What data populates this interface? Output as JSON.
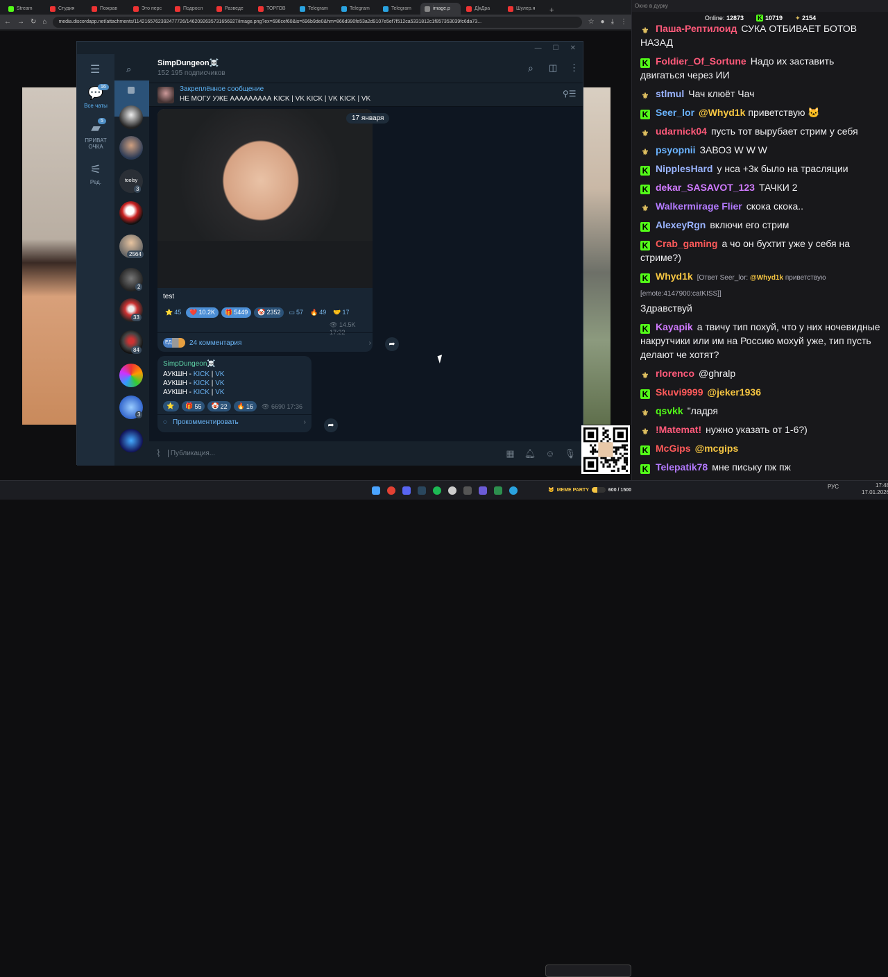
{
  "browser": {
    "tabs": [
      "Stream",
      "Студия",
      "Пожрав",
      "Это перс",
      "Подросл",
      "Разведе",
      "ТОРГОВ",
      "Telegram",
      "Telegram",
      "Telegram",
      "image.p",
      "Д|кДра",
      "Шулер.я"
    ],
    "active_tab_index": 10,
    "new_tab": "+",
    "url": "media.discordapp.net/attachments/1142165762392477726/1462092635731656927/image.png?ex=696cef60&is=696b9de0&hm=866d990fe53a2d9107e5ef7f512ca5331812c1f857353039fc6da73..."
  },
  "telegram": {
    "channel": {
      "name": "SimpDungeon☠️",
      "subscribers": "152 195 подписчиков"
    },
    "folders": [
      {
        "label": "Все чаты",
        "badge": "16",
        "icon": "chats-icon"
      },
      {
        "label": "ПРИВАТ\nОЧКА",
        "badge": "5",
        "icon": "folder-icon"
      },
      {
        "label": "Ред.",
        "badge": "",
        "icon": "edit-icon"
      }
    ],
    "chat_badges": [
      "3",
      "2564",
      "2",
      "33",
      "84",
      "3"
    ],
    "toolsy_label": "toolsy",
    "pinned": {
      "title": "Закреплённое сообщение",
      "text": "НЕ МОГУ УЖЕ ААААААААА  KICK | VK KICK | VK KICK | VK"
    },
    "date": "17 января",
    "post1": {
      "caption": "test",
      "reactions": [
        {
          "emoji": "⭐",
          "count": "45",
          "plain": true
        },
        {
          "emoji": "❤️",
          "count": "10.2K",
          "sel": true
        },
        {
          "emoji": "🎁",
          "count": "5449",
          "sel": true
        },
        {
          "emoji": "🤡",
          "count": "2352",
          "sel": false
        },
        {
          "emoji": "▭",
          "count": "57",
          "plain": true
        },
        {
          "emoji": "🔥",
          "count": "49",
          "plain": true
        },
        {
          "emoji": "🤝",
          "count": "17",
          "plain": true
        }
      ],
      "views": "14.5K",
      "time": "17:22",
      "comments": "24 комментария",
      "comment_avatars": "ЕД"
    },
    "post2": {
      "author": "SimpDungeon☠️",
      "lines": [
        {
          "text": "АУКШН - ",
          "kick": "KICK",
          "sep": " | ",
          "vk": "VK"
        },
        {
          "text": "АУКШН - ",
          "kick": "KICK",
          "sep": " | ",
          "vk": "VK"
        },
        {
          "text": "АУКШН - ",
          "kick": "KICK",
          "sep": " | ",
          "vk": "VK"
        }
      ],
      "reactions": [
        {
          "emoji": "⭐",
          "count": ""
        },
        {
          "emoji": "🎁",
          "count": "55"
        },
        {
          "emoji": "🤡",
          "count": "22"
        },
        {
          "emoji": "🔥",
          "count": "16"
        }
      ],
      "views": "6690",
      "time": "17:36",
      "comment_button": "Прокомментировать"
    },
    "composer_placeholder": "Публикация..."
  },
  "chat": {
    "window_title": "Окно в дурку",
    "online_label": "Online:",
    "online": "12873",
    "kick_count": "10719",
    "twitch_count": "2154",
    "messages": [
      {
        "badge": "w",
        "user": "Паша-Рептилоид",
        "color": "#ff5a7a",
        "text": "СУКА ОТБИВАЕТ БОТОВ НАЗАД"
      },
      {
        "badge": "k",
        "user": "Foldier_Of_Sortune",
        "color": "#ff5a7a",
        "text": "Надо их заставить двигаться через ИИ"
      },
      {
        "badge": "w",
        "user": "stlmul",
        "color": "#9ab4ff",
        "text": "Чач клюёт Чач"
      },
      {
        "badge": "k",
        "user": "Seer_lor",
        "color": "#6ab3ff",
        "mention": "@Whyd1k",
        "mention_color": "#f5c542",
        "text": "приветствую 🐱"
      },
      {
        "badge": "w",
        "user": "udarnick04",
        "color": "#ff5a7a",
        "text": "пусть тот вырубает стрим у себя"
      },
      {
        "badge": "w",
        "user": "psyopnii",
        "color": "#6ab3ff",
        "text": "ЗАВОЗ W W W"
      },
      {
        "badge": "k",
        "user": "NipplesHard",
        "color": "#9ab4ff",
        "text": "у нса +3к было на трасляции"
      },
      {
        "badge": "k",
        "user": "dekar_SASAVOT_123",
        "color": "#d07aff",
        "text": "ТАЧКИ 2"
      },
      {
        "badge": "w",
        "user": "Walkermirage Flier",
        "color": "#b37aff",
        "text": "скока скока.."
      },
      {
        "badge": "k",
        "user": "AlexeyRgn",
        "color": "#9ab4ff",
        "text": "включи его стрим"
      },
      {
        "badge": "k",
        "user": "Crab_gaming",
        "color": "#ff5a5a",
        "text": "а чо он бухтит уже у себя на стриме?)"
      },
      {
        "badge": "k",
        "user": "Whyd1k",
        "color": "#f5c542",
        "reply": "[Ответ Seer_lor: ",
        "reply_mention": "@Whyd1k",
        "reply_end": " приветствую [emote:4147900:catKISS]]",
        "text": "Здравствуй"
      },
      {
        "badge": "k",
        "user": "Kayapik",
        "color": "#d07aff",
        "text": "а твичу тип похуй, что у них ночевидные накрутчики или им на Россию мохуй уже, тип пусть делают че хотят?"
      },
      {
        "badge": "w",
        "user": "rlorenco",
        "color": "#ff5a7a",
        "text": "@ghralp"
      },
      {
        "badge": "k",
        "user": "Skuvi9999",
        "color": "#ff5a5a",
        "mention": "@jeker1936",
        "mention_color": "#f5c542",
        "text": ""
      },
      {
        "badge": "w",
        "user": "qsvkk",
        "color": "#53fc18",
        "text": "\"ладря"
      },
      {
        "badge": "w",
        "user": "!Matemat!",
        "color": "#ff5a7a",
        "text": "нужно указать от 1-6?)"
      },
      {
        "badge": "k",
        "user": "McGips",
        "color": "#ff5a5a",
        "mention": "@mcgips",
        "mention_color": "#f5c542",
        "text": ""
      },
      {
        "badge": "k",
        "user": "Telepatik78",
        "color": "#b37aff",
        "text": "мне письку пж пж"
      }
    ]
  },
  "overlay": {
    "meme_party": "MEME PARTY",
    "progress_text": "600 / 1500"
  },
  "taskbar": {
    "lang": "РУС",
    "time": "17:48",
    "date": "17.01.2026"
  }
}
